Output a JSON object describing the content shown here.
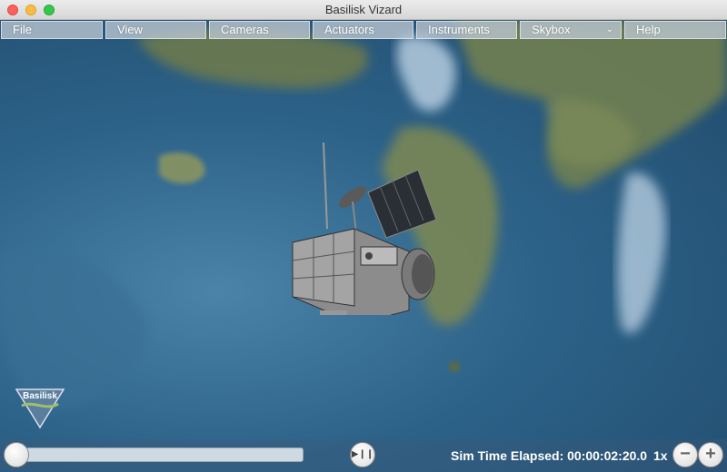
{
  "window": {
    "title": "Basilisk Vizard"
  },
  "menu": [
    {
      "label": "File"
    },
    {
      "label": "View"
    },
    {
      "label": "Cameras"
    },
    {
      "label": "Actuators"
    },
    {
      "label": "Instruments"
    },
    {
      "label": "Skybox",
      "has_dropdown": true
    },
    {
      "label": "Help"
    }
  ],
  "playback": {
    "sim_time": "Sim Time Elapsed: 00:00:02:20.0",
    "speed": "1x",
    "slider_position": 0.0
  },
  "logo": {
    "text": "Basilisk"
  },
  "icons": {
    "play_pause": "play-pause-icon",
    "zoom_out": "minus-icon",
    "zoom_in": "plus-icon"
  },
  "colors": {
    "menu_bg": "#c0c8d0",
    "ocean": "#2d6288",
    "land": "#6b7b4a"
  }
}
